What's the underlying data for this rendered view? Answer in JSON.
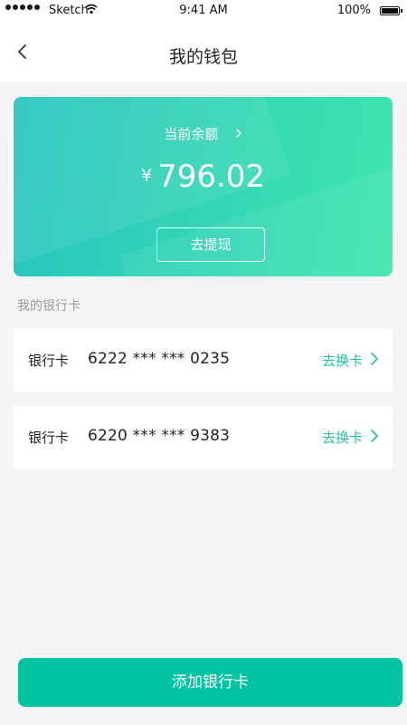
{
  "status_bar": {
    "carrier": "Sketch",
    "time": "9:41 AM",
    "battery": "100%"
  },
  "nav": {
    "title": "我的钱包"
  },
  "balance": {
    "label": "当前余额",
    "currency": "¥",
    "amount": "796.02",
    "withdraw_label": "去提现"
  },
  "section": {
    "title": "我的银行卡"
  },
  "cards": [
    {
      "label": "银行卡",
      "number": "6222 *** *** 0235",
      "action": "去换卡"
    },
    {
      "label": "银行卡",
      "number": "6220 *** *** 9383",
      "action": "去换卡"
    }
  ],
  "footer": {
    "add_card_label": "添加银行卡"
  },
  "colors": {
    "accent": "#00c3a0",
    "link": "#1cc6a3",
    "gradient_start": "#27c4c0",
    "gradient_end": "#3ee6ae"
  }
}
